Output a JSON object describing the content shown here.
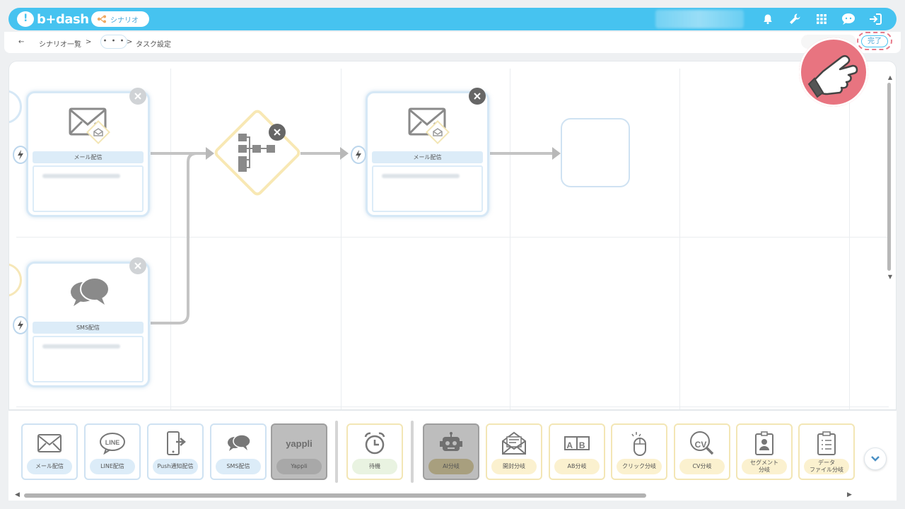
{
  "app": {
    "logo_text": "b+dash",
    "module_label": "シナリオ"
  },
  "header": {
    "icons": [
      "bell-icon",
      "wrench-icon",
      "apps-grid-icon",
      "chat-support-icon",
      "logout-icon"
    ]
  },
  "breadcrumb": {
    "back": "←",
    "list": "シナリオ一覧",
    "sep1": ">",
    "ellipsis": "・・・",
    "sep2": ">",
    "current": "タスク設定"
  },
  "actions": {
    "done_label": "完了"
  },
  "canvas": {
    "nodes": [
      {
        "title": "メール配信",
        "icon": "mail-icon"
      },
      {
        "title": "SMS配信",
        "icon": "sms-icon"
      },
      {
        "title": "メール配信",
        "icon": "mail-icon"
      }
    ],
    "branch_icon": "branch-icon"
  },
  "palette": {
    "items": [
      {
        "label": "メール配信",
        "icon": "mail-icon",
        "group": "delivery"
      },
      {
        "label": "LINE配信",
        "icon": "line-icon",
        "group": "delivery"
      },
      {
        "label": "Push通知配信",
        "icon": "push-icon",
        "group": "delivery"
      },
      {
        "label": "SMS配信",
        "icon": "sms-icon",
        "group": "delivery"
      },
      {
        "label": "Yappli",
        "icon_text": "yappli",
        "group": "delivery-disabled"
      },
      {
        "label": "待機",
        "icon": "alarm-clock-icon",
        "group": "wait"
      },
      {
        "label": "AI分岐",
        "icon": "robot-icon",
        "group": "branch-disabled"
      },
      {
        "label": "開封分岐",
        "icon": "open-mail-icon",
        "group": "branch"
      },
      {
        "label": "AB分岐",
        "icon_text": "A B",
        "group": "branch"
      },
      {
        "label": "クリック分岐",
        "icon": "mouse-click-icon",
        "group": "branch"
      },
      {
        "label": "CV分岐",
        "icon_text": "CV",
        "group": "branch"
      },
      {
        "label": "セグメント\n分岐",
        "icon": "badge-icon",
        "group": "branch"
      },
      {
        "label": "データ\nファイル分岐",
        "icon": "clipboard-icon",
        "group": "branch"
      }
    ]
  },
  "colors": {
    "header": "#46c3f0",
    "node_border": "#d6e8f6",
    "branch_border": "#f3e6b5",
    "pointer": "#e87480"
  }
}
